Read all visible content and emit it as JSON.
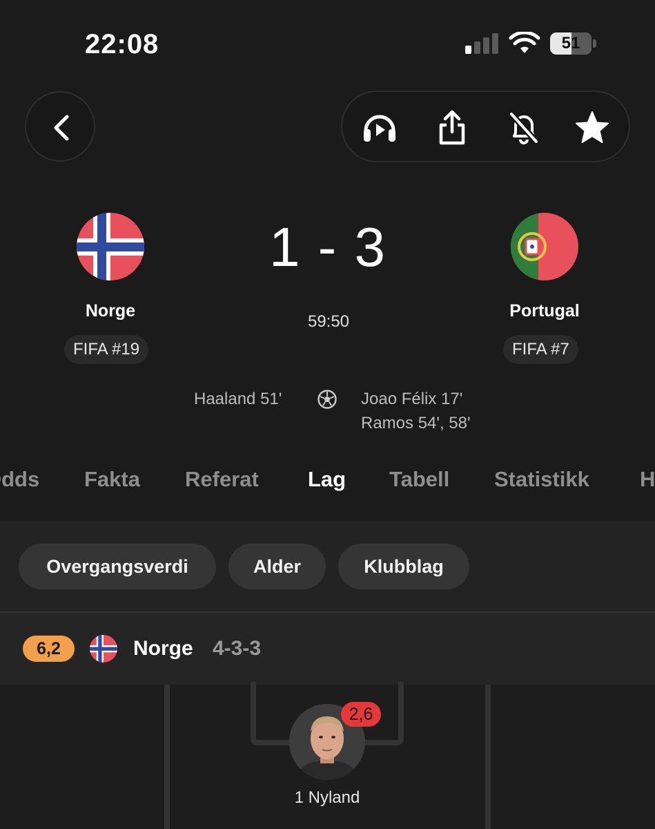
{
  "status_bar": {
    "time": "22:08",
    "battery": "51",
    "battery_level": 0.51
  },
  "nav": {
    "back_icon": "chevron-left-icon",
    "actions": [
      "headphones-play-icon",
      "share-icon",
      "bell-off-icon",
      "star-icon"
    ]
  },
  "match": {
    "home": {
      "name": "Norge",
      "rank": "FIFA #19",
      "flag": "norway-flag"
    },
    "away": {
      "name": "Portugal",
      "rank": "FIFA #7",
      "flag": "portugal-flag"
    },
    "score": "1 - 3",
    "clock": "59:50",
    "home_scorers": [
      "Haaland 51'"
    ],
    "away_scorers": [
      "Joao Félix 17'",
      "Ramos 54', 58'"
    ]
  },
  "tabs": [
    {
      "label": "Odds",
      "active": false
    },
    {
      "label": "Fakta",
      "active": false
    },
    {
      "label": "Referat",
      "active": false
    },
    {
      "label": "Lag",
      "active": true
    },
    {
      "label": "Tabell",
      "active": false
    },
    {
      "label": "Statistikk",
      "active": false
    },
    {
      "label": "H",
      "active": false
    }
  ],
  "filters": [
    "Overgangsverdi",
    "Alder",
    "Klubblag"
  ],
  "lineup": {
    "rating": "6,2",
    "team": "Norge",
    "formation": "4-3-3",
    "players": [
      {
        "name": "1 Nyland",
        "rating": "2,6"
      }
    ]
  },
  "colors": {
    "background": "#1b1b1b",
    "chip": "#353535",
    "team_rating": "#f2a04c",
    "player_rating": "#e5383b",
    "tab_inactive": "#8e8e8e"
  }
}
